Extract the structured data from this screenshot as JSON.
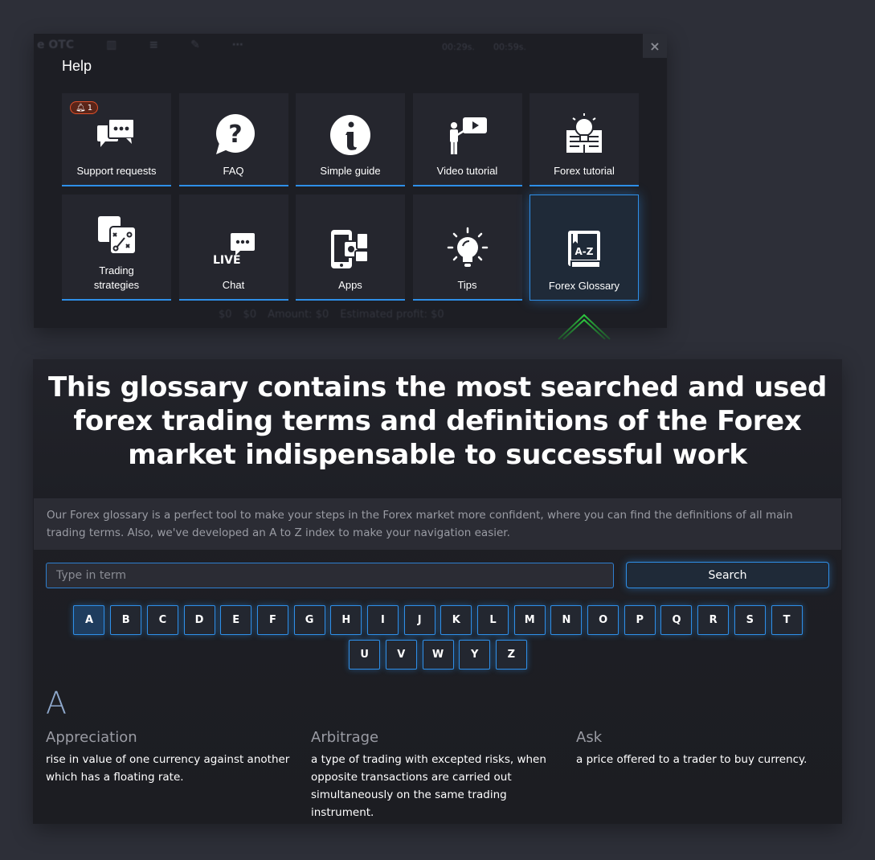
{
  "background_app": {
    "asset_label": "e OTC",
    "timers": [
      "00:29s.",
      "00:59s."
    ],
    "bottom_bar": [
      "$0",
      "$0",
      "Amount: $0",
      "Estimated profit: $0"
    ]
  },
  "help_panel": {
    "title": "Help",
    "close_icon": "×",
    "tiles": [
      {
        "label": "Support requests",
        "icon": "chat-bubbles-icon",
        "badge": "1"
      },
      {
        "label": "FAQ",
        "icon": "question-bubble-icon"
      },
      {
        "label": "Simple guide",
        "icon": "info-circle-icon"
      },
      {
        "label": "Video tutorial",
        "icon": "presenter-video-icon"
      },
      {
        "label": "Forex tutorial",
        "icon": "lightbulb-book-icon"
      },
      {
        "label": "Trading strategies",
        "icon": "strategy-board-icon"
      },
      {
        "label": "Chat",
        "icon": "live-chat-icon",
        "icon_text": "LIVE"
      },
      {
        "label": "Apps",
        "icon": "devices-icon"
      },
      {
        "label": "Tips",
        "icon": "lightbulb-icon"
      },
      {
        "label": "Forex Glossary",
        "icon": "az-book-icon",
        "icon_text": "A-Z",
        "active": true
      }
    ]
  },
  "glossary": {
    "hero_title": "This glossary contains the most searched and used forex trading terms and definitions of the Forex market indispensable to successful work",
    "intro": "Our Forex glossary is a perfect tool to make your steps in the Forex market more confident, where you can find the definitions of all main trading terms. Also, we've developed an A to Z index to make your navigation easier.",
    "search": {
      "placeholder": "Type in term",
      "value": "",
      "button_label": "Search"
    },
    "letters": [
      "A",
      "B",
      "C",
      "D",
      "E",
      "F",
      "G",
      "H",
      "I",
      "J",
      "K",
      "L",
      "M",
      "N",
      "O",
      "P",
      "Q",
      "R",
      "S",
      "T",
      "U",
      "V",
      "W",
      "Y",
      "Z"
    ],
    "active_letter": "A",
    "section_letter": "A",
    "terms": [
      {
        "name": "Appreciation",
        "definition": "rise in value of one currency against another which has a floating rate."
      },
      {
        "name": "Arbitrage",
        "definition": "a type of trading with excepted risks, when opposite transactions are carried out simultaneously on the same trading instrument."
      },
      {
        "name": "Ask",
        "definition": "a price offered to a trader to buy currency."
      }
    ]
  },
  "colors": {
    "accent": "#2e8fe8",
    "badge": "#e0502a",
    "pointer": "#2ecc40",
    "page_bg": "#2d2f38"
  }
}
